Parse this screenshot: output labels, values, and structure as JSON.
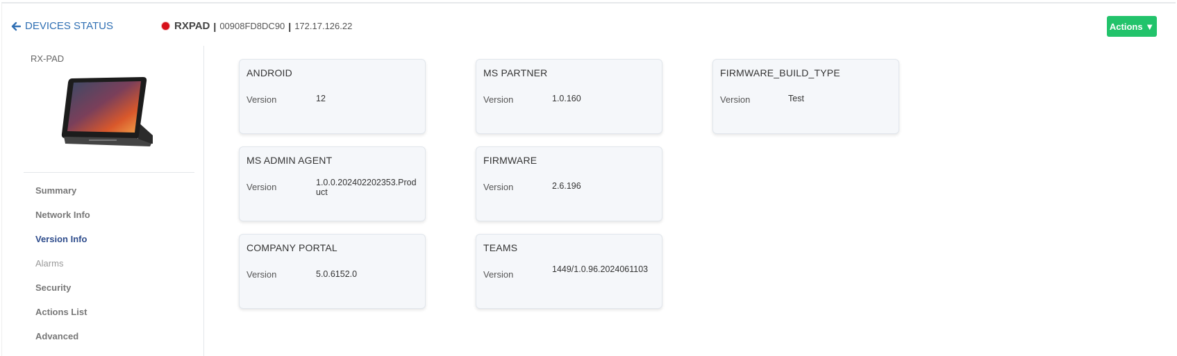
{
  "header": {
    "back_label": "DEVICES STATUS",
    "device_name": "RXPAD",
    "separator": "|",
    "mac": "00908FD8DC90",
    "ip": "172.17.126.22",
    "status_color": "#d7101a",
    "actions_label": "Actions ▼"
  },
  "sidebar": {
    "device_model": "RX-PAD",
    "items": [
      {
        "label": "Summary"
      },
      {
        "label": "Network Info"
      },
      {
        "label": "Version Info"
      },
      {
        "label": "Alarms"
      },
      {
        "label": "Security"
      },
      {
        "label": "Actions List"
      },
      {
        "label": "Advanced"
      }
    ],
    "active_item": "Version Info"
  },
  "cards": [
    {
      "title": "ANDROID",
      "key": "Version",
      "value": "12"
    },
    {
      "title": "MS PARTNER",
      "key": "Version",
      "value": "1.0.160"
    },
    {
      "title": "FIRMWARE_BUILD_TYPE",
      "key": "Version",
      "value": "Test"
    },
    {
      "title": "MS ADMIN AGENT",
      "key": "Version",
      "value": "1.0.0.202402202353.Product"
    },
    {
      "title": "FIRMWARE",
      "key": "Version",
      "value": "2.6.196"
    },
    {
      "title": "COMPANY PORTAL",
      "key": "Version",
      "value": "5.0.6152.0"
    },
    {
      "title": "TEAMS",
      "key": "Version",
      "value": "1449/1.0.96.2024061103"
    }
  ],
  "colors": {
    "accent": "#2f6fb3",
    "actions_button": "#22c36b",
    "active_nav": "#2e4c8c"
  }
}
